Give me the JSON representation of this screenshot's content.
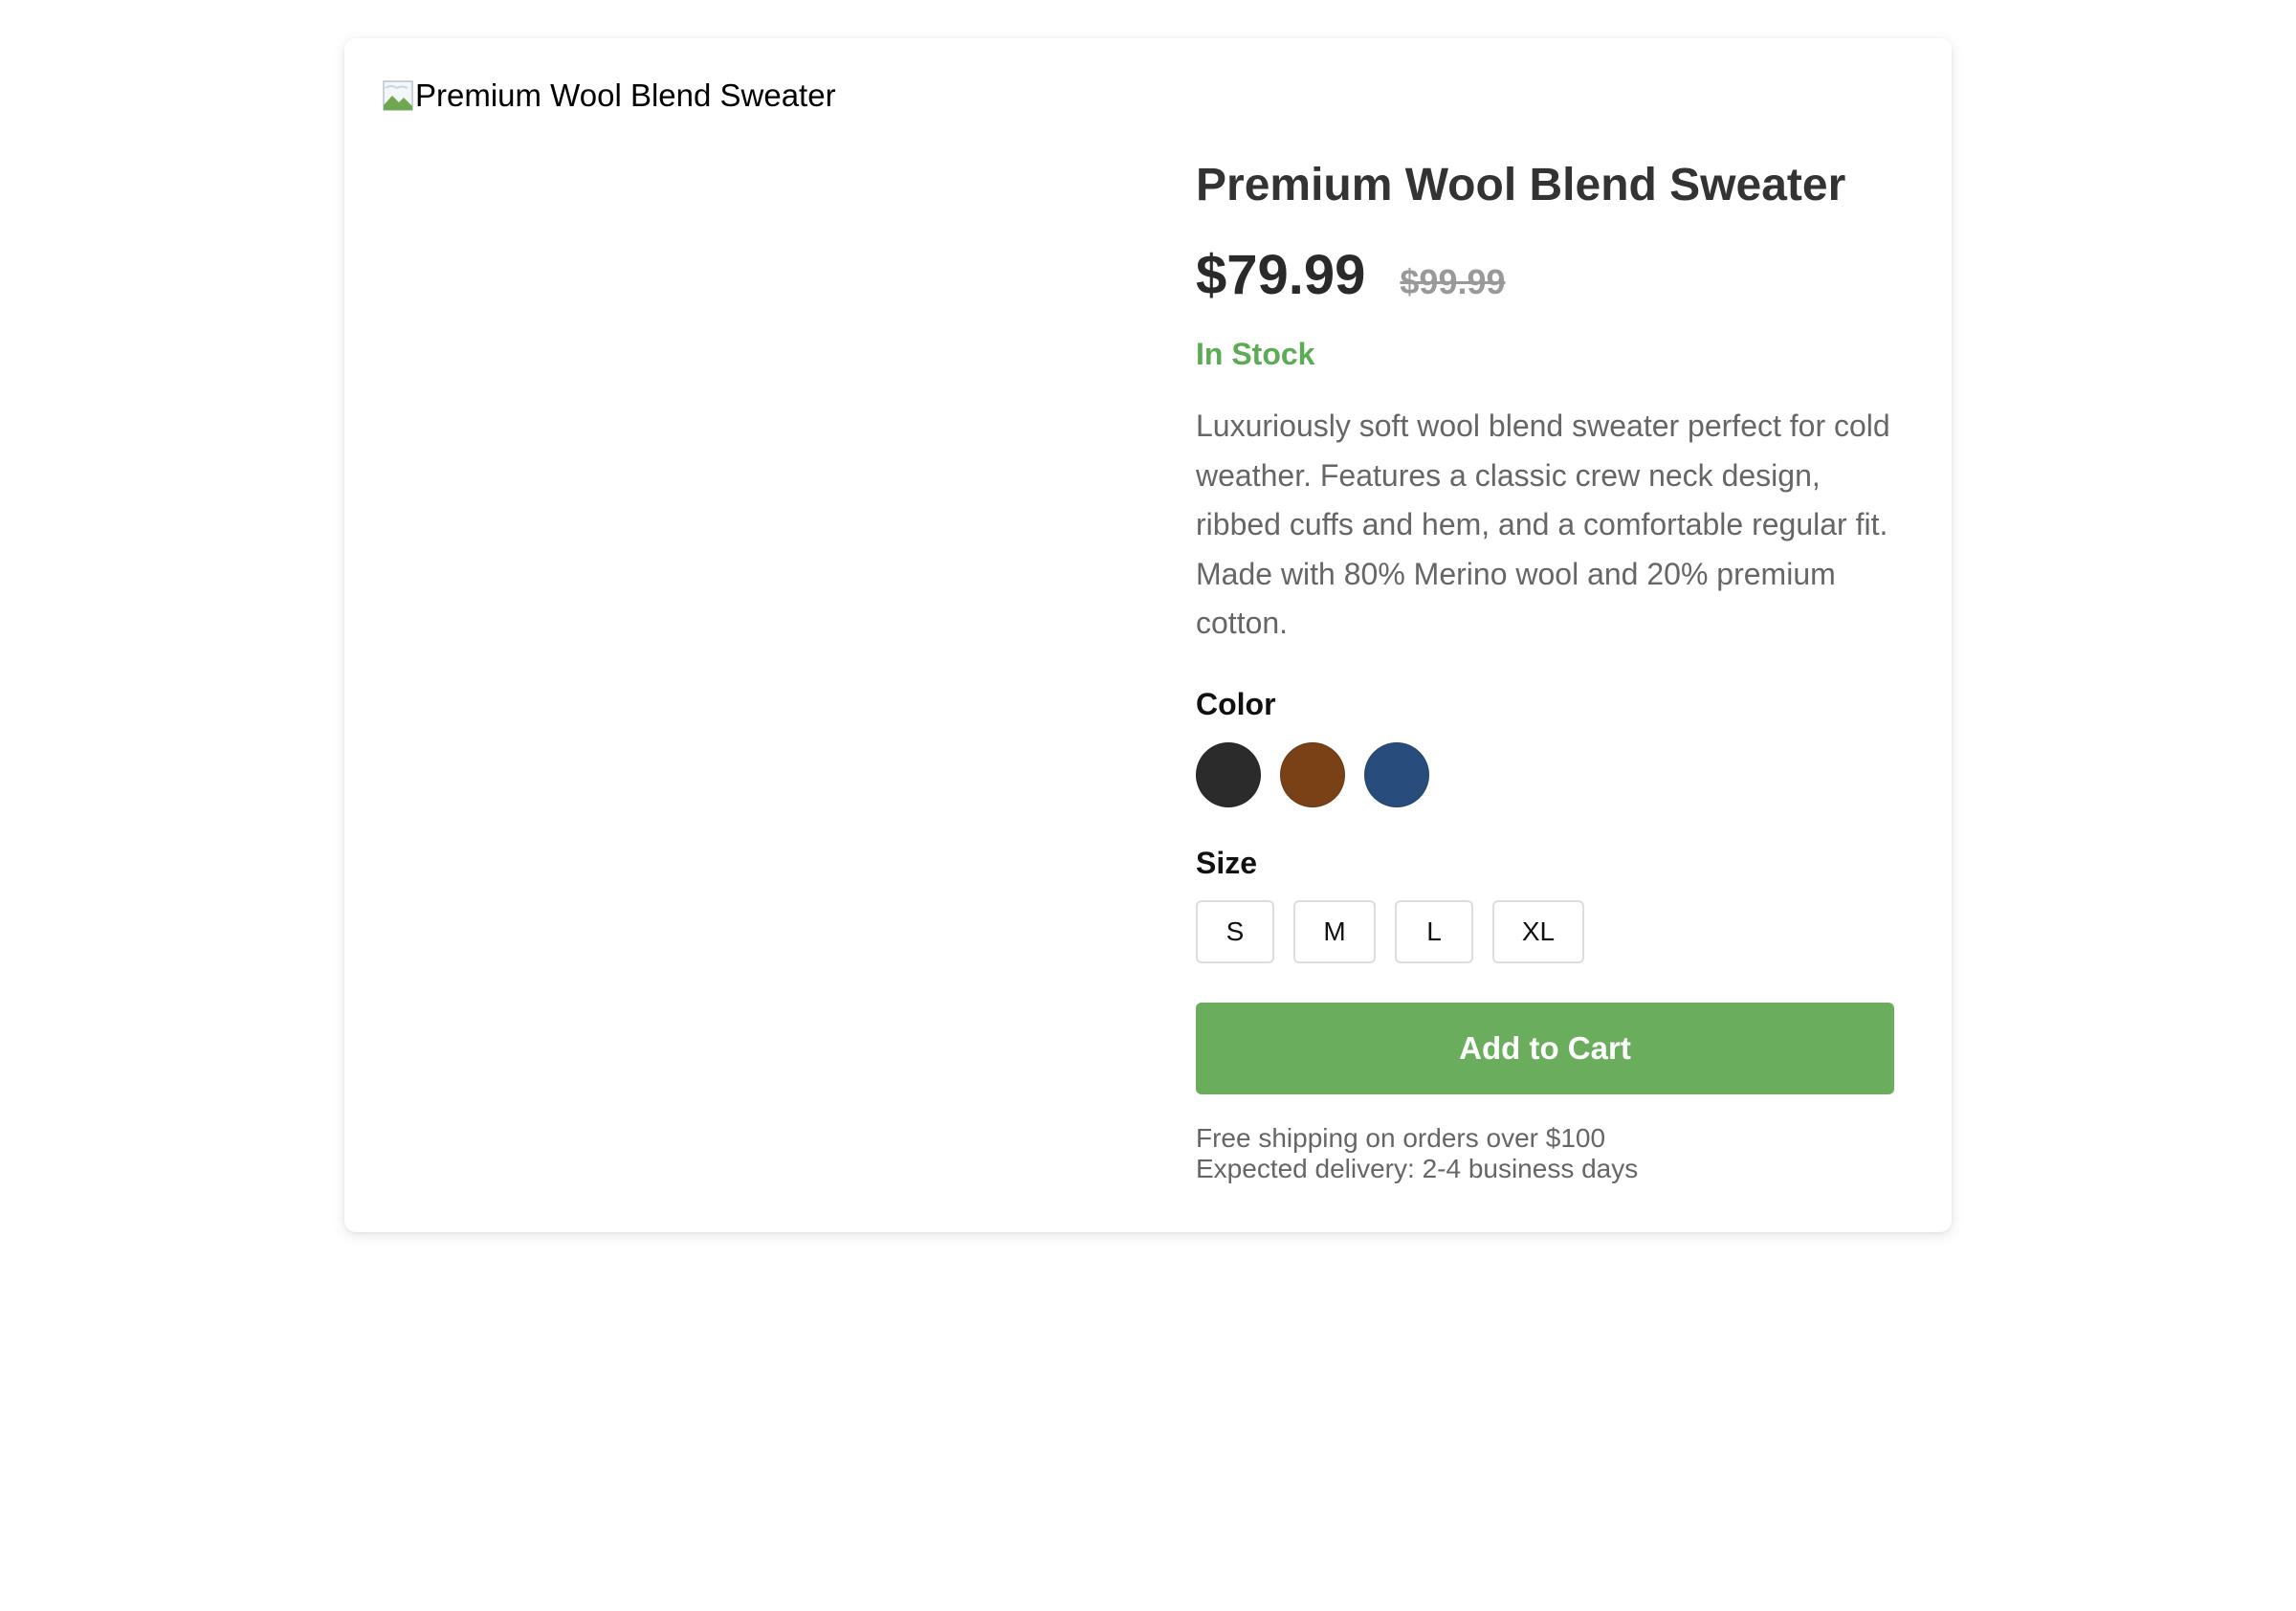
{
  "product": {
    "image_alt": "Premium Wool Blend Sweater",
    "title": "Premium Wool Blend Sweater",
    "price": "$79.99",
    "original_price": "$99.99",
    "stock_status": "In Stock",
    "stock_color": "#5cab55",
    "description": "Luxuriously soft wool blend sweater perfect for cold weather. Features a classic crew neck design, ribbed cuffs and hem, and a comfortable regular fit. Made with 80% Merino wool and 20% premium cotton."
  },
  "color_section": {
    "label": "Color",
    "swatches": [
      {
        "name": "black",
        "hex": "#2b2b2b"
      },
      {
        "name": "brown",
        "hex": "#7a4116"
      },
      {
        "name": "navy",
        "hex": "#284d7c"
      }
    ]
  },
  "size_section": {
    "label": "Size",
    "options": [
      "S",
      "M",
      "L",
      "XL"
    ]
  },
  "cart": {
    "button_label": "Add to Cart",
    "button_color": "#6aae5d"
  },
  "shipping": {
    "line1": "Free shipping on orders over $100",
    "line2": "Expected delivery: 2-4 business days"
  }
}
